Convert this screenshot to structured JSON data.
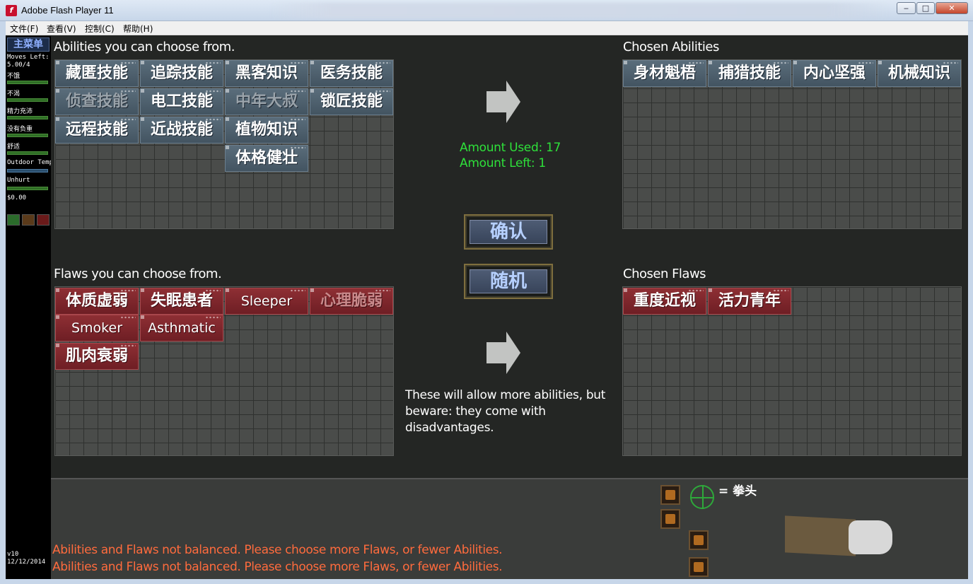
{
  "window": {
    "title": "Adobe Flash Player 11",
    "min_label": "‒",
    "max_label": "□",
    "close_label": "✕"
  },
  "menu": [
    "文件(F)",
    "查看(V)",
    "控制(C)",
    "帮助(H)"
  ],
  "sidebar": {
    "main_menu": "主菜单",
    "stats": [
      "Moves Left:",
      "5.00/4",
      "不饿",
      "不渴",
      "精力充沛",
      "没有负重",
      "舒适",
      "Outdoor Temp",
      "Unhurt",
      "$0.00"
    ],
    "version": "v10",
    "date": "12/12/2014"
  },
  "abilities_title": "Abilities you can choose from.",
  "chosen_abilities_title": "Chosen Abilities",
  "flaws_title": "Flaws you can choose from.",
  "chosen_flaws_title": "Chosen Flaws",
  "abilities": [
    "藏匿技能",
    "追踪技能",
    "黑客知识",
    "医务技能",
    "侦查技能",
    "电工技能",
    "中年大叔",
    "锁匠技能",
    "远程技能",
    "近战技能",
    "植物知识",
    "体格健壮"
  ],
  "chosen_abilities": [
    "身材魁梧",
    "捕猎技能",
    "内心坚强",
    "机械知识"
  ],
  "flaws": [
    "体质虚弱",
    "失眠患者",
    "Sleeper",
    "心理脆弱",
    "Smoker",
    "Asthmatic",
    "肌肉衰弱"
  ],
  "chosen_flaws": [
    "重度近视",
    "活力青年"
  ],
  "amount_used": "Amount Used: 17",
  "amount_left": "Amount Left: 1",
  "confirm_label": "确认",
  "random_label": "随机",
  "hint": "These will allow more abilities, but beware: they come with disadvantages.",
  "warnings": [
    "Abilities and Flaws not balanced. Please choose more Flaws, or fewer Abilities.",
    "Abilities and Flaws not balanced. Please choose more Flaws, or fewer Abilities."
  ],
  "weapon": "= 拳头",
  "colors": {
    "amount_text": "#2ee03a",
    "warning_text": "#ff6b3d",
    "ability_tile": "#4f6170",
    "flaw_tile": "#7e262c"
  }
}
